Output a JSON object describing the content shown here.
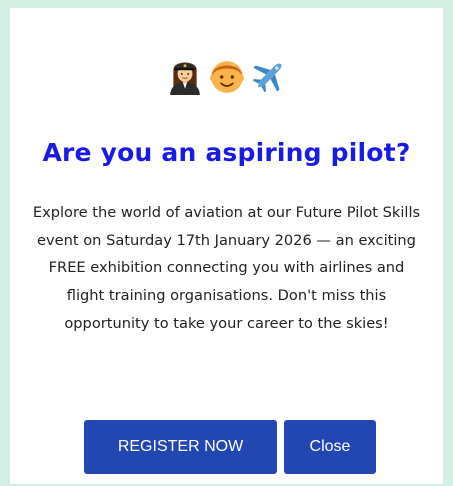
{
  "popup": {
    "emojis": [
      "woman-pilot-icon",
      "boy-face-icon",
      "airplane-icon"
    ],
    "title": "Are you an aspiring pilot?",
    "body": "Explore the world of aviation at our Future Pilot Skills event on Saturday 17th January 2026 — an exciting FREE exhibition connecting you with airlines and flight training organisations. Don't miss this opportunity to take your career to the skies!",
    "buttons": {
      "register_label": "REGISTER NOW",
      "close_label": "Close"
    }
  },
  "colors": {
    "page_background": "#d3f0e4",
    "title": "#1a1ae6",
    "button": "#2347b2"
  }
}
